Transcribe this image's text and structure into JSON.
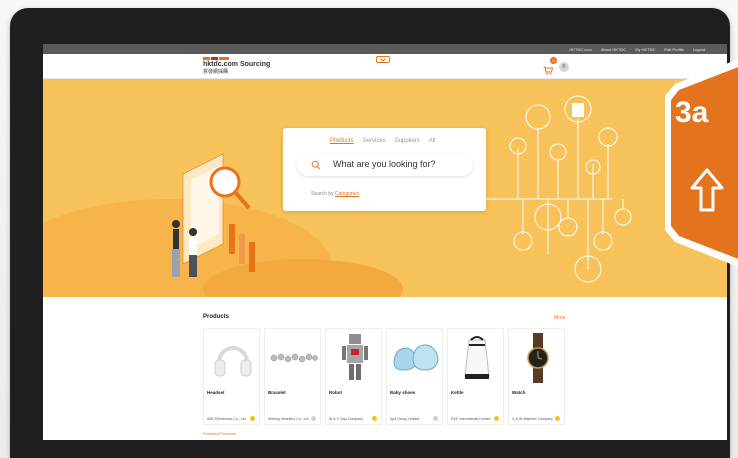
{
  "util_bar": {
    "items": [
      "HKTDC.com",
      "About HKTDC",
      "My HKTDC",
      "Edit Profile",
      "Logout"
    ]
  },
  "header": {
    "logo_en": "hktdc.com Sourcing",
    "logo_zh": "貿發網採購",
    "cart_count": "0",
    "avatar_initial": "B"
  },
  "search": {
    "tabs": [
      "Products",
      "Services",
      "Suppliers",
      "All"
    ],
    "active_tab": "Products",
    "placeholder": "What are you looking for?",
    "search_by_prefix": "Search by",
    "categories_link": "Categories"
  },
  "products": {
    "title": "Products",
    "more_label": "More",
    "items": [
      {
        "name": "Headset",
        "supplier": "ABC Electronics Co., Ltd.",
        "dot": "#f2c21a"
      },
      {
        "name": "Bracelet",
        "supplier": "Shining Jewellery Co., Ltd.",
        "dot": "#d0d0d0"
      },
      {
        "name": "Robot",
        "supplier": "W & X Toys Company",
        "dot": "#f2c21a"
      },
      {
        "name": "Baby shoes",
        "supplier": "Apd Group Limited",
        "dot": "#d0d0d0"
      },
      {
        "name": "Kettle",
        "supplier": "P&E International Limited",
        "dot": "#f2c21a"
      },
      {
        "name": "Watch",
        "supplier": "G & W Watches Company",
        "dot": "#f2c21a"
      }
    ],
    "footer_link": "Featured Products"
  },
  "badge": {
    "label": "3a",
    "icon": "up-arrow-icon"
  },
  "colors": {
    "accent": "#e8731a",
    "hero": "#f8c25a",
    "badge": "#e4731d"
  }
}
